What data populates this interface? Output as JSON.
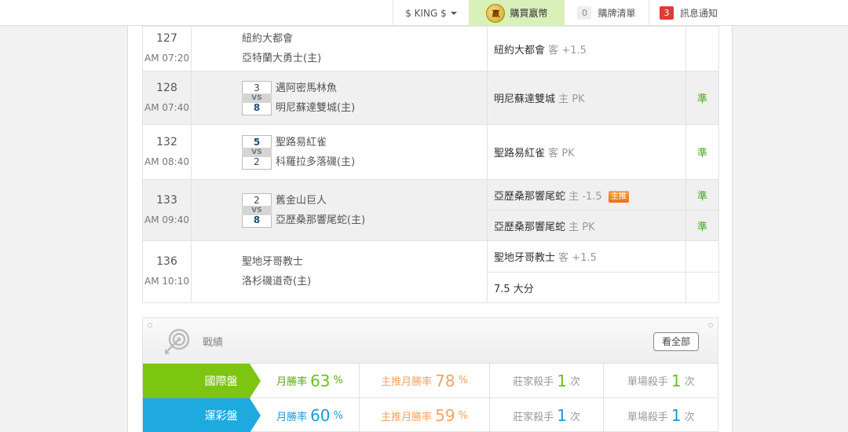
{
  "topbar": {
    "user_label": "$ KING $",
    "coin_label": "嬴",
    "buy_label": "購買嬴幣",
    "cart_count": "0",
    "cart_label": "購牌清單",
    "msg_count": "3",
    "msg_label": "訊息通知"
  },
  "games": [
    {
      "num": "127",
      "time": "AM 07:20",
      "away": "紐約大都會",
      "home": "亞特蘭大勇士(主)",
      "away_score": "",
      "home_score": "",
      "vs": "",
      "picks": [
        {
          "team": "紐約大都會",
          "side": "客",
          "line": "+1.5",
          "badge": "",
          "mark": ""
        }
      ]
    },
    {
      "num": "128",
      "time": "AM 07:40",
      "away": "邁阿密馬林魚",
      "home": "明尼蘇達雙城(主)",
      "away_score": "3",
      "home_score": "8",
      "vs": "VS",
      "picks": [
        {
          "team": "明尼蘇達雙城",
          "side": "主",
          "line": "PK",
          "badge": "",
          "mark": "準"
        }
      ]
    },
    {
      "num": "132",
      "time": "AM 08:40",
      "away": "聖路易紅雀",
      "home": "科羅拉多落磯(主)",
      "away_score": "5",
      "home_score": "2",
      "vs": "VS",
      "picks": [
        {
          "team": "聖路易紅雀",
          "side": "客",
          "line": "PK",
          "badge": "",
          "mark": "準"
        }
      ]
    },
    {
      "num": "133",
      "time": "AM 09:40",
      "away": "舊金山巨人",
      "home": "亞歷桑那響尾蛇(主)",
      "away_score": "2",
      "home_score": "8",
      "vs": "VS",
      "picks": [
        {
          "team": "亞歷桑那響尾蛇",
          "side": "主",
          "line": "-1.5",
          "badge": "主推",
          "mark": "準"
        },
        {
          "team": "亞歷桑那響尾蛇",
          "side": "主",
          "line": "PK",
          "badge": "",
          "mark": "準"
        }
      ]
    },
    {
      "num": "136",
      "time": "AM 10:10",
      "away": "聖地牙哥教士",
      "home": "洛杉磯道奇(主)",
      "away_score": "",
      "home_score": "",
      "vs": "",
      "picks": [
        {
          "team": "聖地牙哥教士",
          "side": "客",
          "line": "+1.5",
          "badge": "",
          "mark": ""
        },
        {
          "team": "7.5 大分",
          "side": "",
          "line": "",
          "badge": "",
          "mark": ""
        }
      ]
    }
  ],
  "record": {
    "title": "戰績",
    "see_all": "看全部",
    "rows": [
      {
        "label": "國際盤",
        "color": "green",
        "month_label": "月勝率",
        "month_val": "63",
        "month_unit": "%",
        "top_label": "主推月勝率",
        "top_val": "78",
        "top_unit": "%",
        "banker_label": "莊家殺手",
        "banker_val": "1",
        "banker_unit": "次",
        "single_label": "單場殺手",
        "single_val": "1",
        "single_unit": "次"
      },
      {
        "label": "運彩盤",
        "color": "blue",
        "month_label": "月勝率",
        "month_val": "60",
        "month_unit": "%",
        "top_label": "主推月勝率",
        "top_val": "59",
        "top_unit": "%",
        "banker_label": "莊家殺手",
        "banker_val": "1",
        "banker_unit": "次",
        "single_label": "單場殺手",
        "single_val": "1",
        "single_unit": "次"
      }
    ]
  }
}
